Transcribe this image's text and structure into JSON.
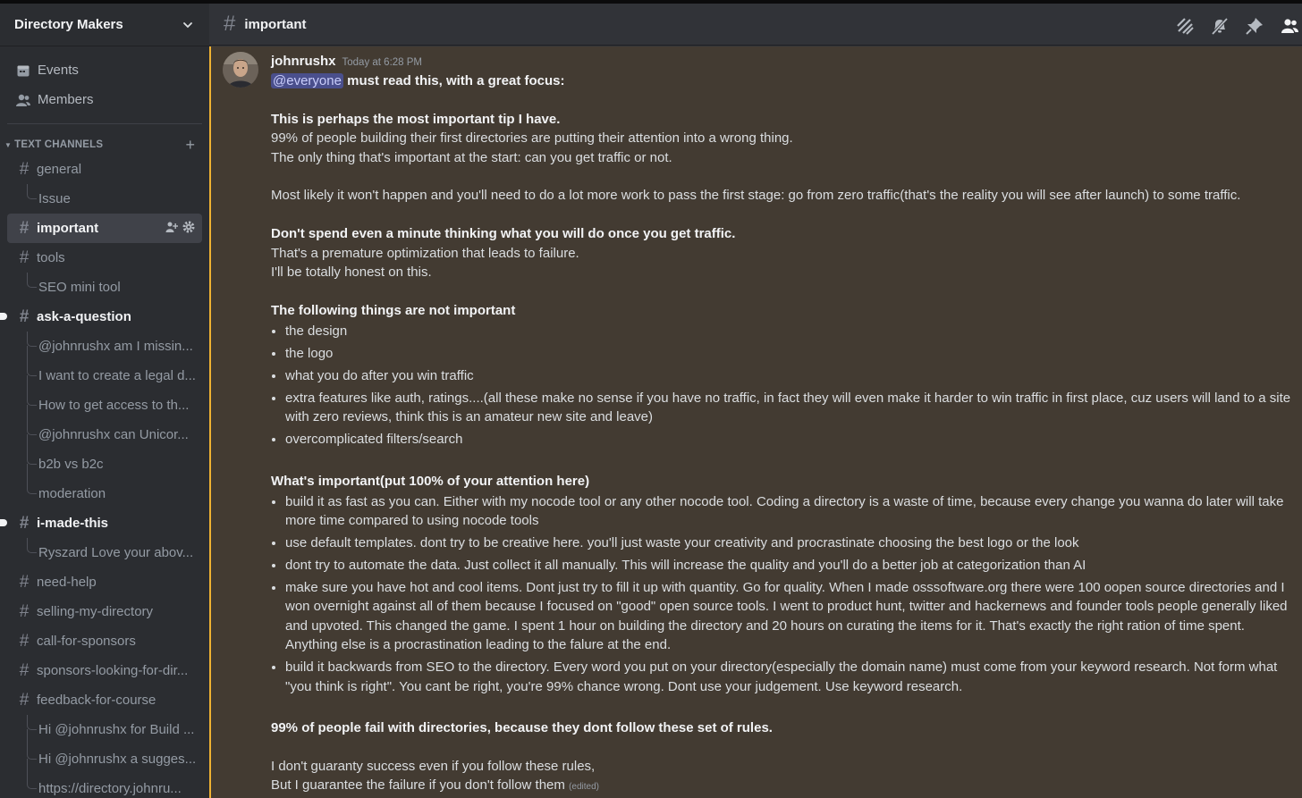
{
  "server": {
    "name": "Directory Makers"
  },
  "top_links": [
    {
      "label": "Events",
      "icon": "calendar-icon"
    },
    {
      "label": "Members",
      "icon": "members-icon"
    }
  ],
  "category": {
    "label": "TEXT CHANNELS"
  },
  "sidebar": {
    "items": [
      {
        "kind": "channel",
        "label": "general"
      },
      {
        "kind": "thread",
        "label": "Issue"
      },
      {
        "kind": "channel",
        "label": "important",
        "selected": true
      },
      {
        "kind": "channel",
        "label": "tools"
      },
      {
        "kind": "thread",
        "label": "SEO mini tool"
      },
      {
        "kind": "channel",
        "label": "ask-a-question",
        "unread": true
      },
      {
        "kind": "thread",
        "label": "@johnrushx am I missin..."
      },
      {
        "kind": "thread",
        "label": "I want to create a legal d..."
      },
      {
        "kind": "thread",
        "label": "How to get access to th..."
      },
      {
        "kind": "thread",
        "label": "@johnrushx can Unicor..."
      },
      {
        "kind": "thread",
        "label": "b2b vs b2c"
      },
      {
        "kind": "thread",
        "label": "moderation"
      },
      {
        "kind": "channel",
        "label": "i-made-this",
        "unread": true
      },
      {
        "kind": "thread",
        "label": "Ryszard Love your abov..."
      },
      {
        "kind": "channel",
        "label": "need-help"
      },
      {
        "kind": "channel",
        "label": "selling-my-directory"
      },
      {
        "kind": "channel",
        "label": "call-for-sponsors"
      },
      {
        "kind": "channel",
        "label": "sponsors-looking-for-dir..."
      },
      {
        "kind": "channel",
        "label": "feedback-for-course"
      },
      {
        "kind": "thread",
        "label": "Hi @johnrushx for Build ..."
      },
      {
        "kind": "thread",
        "label": "Hi @johnrushx a sugges..."
      },
      {
        "kind": "thread",
        "label": "https://directory.johnru..."
      }
    ]
  },
  "header": {
    "channel": "important",
    "icons": [
      "threads-icon",
      "mute-bell-icon",
      "pin-icon",
      "member-list-icon"
    ]
  },
  "message": {
    "author": "johnrushx",
    "timestamp": "Today at 6:28 PM",
    "mention": "@everyone",
    "intro": " must read this, with a great focus:",
    "p1_bold": "This is perhaps the most important tip I have.",
    "p1_l2": "99% of people building their first directories are putting their attention into a wrong thing.",
    "p1_l3": "The only thing that's important at the start: can you get traffic or not.",
    "p2": "Most likely it won't happen and you'll need to do a lot more work to pass the first stage: go from zero traffic(that's the reality you will see after launch) to some traffic.",
    "p3_bold": "Don't spend even a minute thinking what you will do once you get traffic.",
    "p3_l2": "That's a premature optimization that leads to failure.",
    "p3_l3": "I'll be totally honest on this.",
    "not_important_title": "The following things are not important",
    "not_important": [
      "the design",
      "the logo",
      "what you do after you win traffic",
      "extra features like auth, ratings....(all these make no sense if you have no traffic, in fact they will even make it harder to win traffic in first place, cuz users will land to a site with zero reviews, think this is an amateur new site and leave)",
      "overcomplicated filters/search"
    ],
    "important_title": "What's important(put 100% of your attention here)",
    "important": [
      "build it as fast as you can. Either with my nocode tool or any other nocode tool. Coding a directory is a waste of time, because every change you wanna do later will take more time compared to using nocode tools",
      "use default templates. dont try to be creative here. you'll just waste your creativity and procrastinate choosing the best logo or the look",
      "dont try to automate the data. Just collect it all manually. This will increase the quality and you'll do a better job at categorization than AI",
      "make sure you have hot and cool items. Dont just try to fill it up with quantity. Go for quality. When I made osssoftware.org there were 100 oopen source directories and I won overnight against all of them because I focused on \"good\" open source tools. I went to product hunt, twitter and hackernews and founder tools people generally liked and upvoted. This changed the game. I spent 1 hour on building the directory and 20 hours on curating the items for it. That's exactly the right ration of time spent. Anything else is a procrastination leading to the falure at the end.",
      "build it backwards from SEO to the directory. Every word you put on your directory(especially the domain name) must come from your keyword research. Not form what \"you think is right\". You cant be right, you're 99% chance wrong. Dont use your judgement. Use keyword research."
    ],
    "conclusion_bold": "99% of people fail with directories, because they dont follow these set of rules.",
    "closing_l1": "I don't guaranty success even if you follow these rules,",
    "closing_l2": "But I guarantee the failure if you don't follow them",
    "edited_label": "(edited)"
  }
}
